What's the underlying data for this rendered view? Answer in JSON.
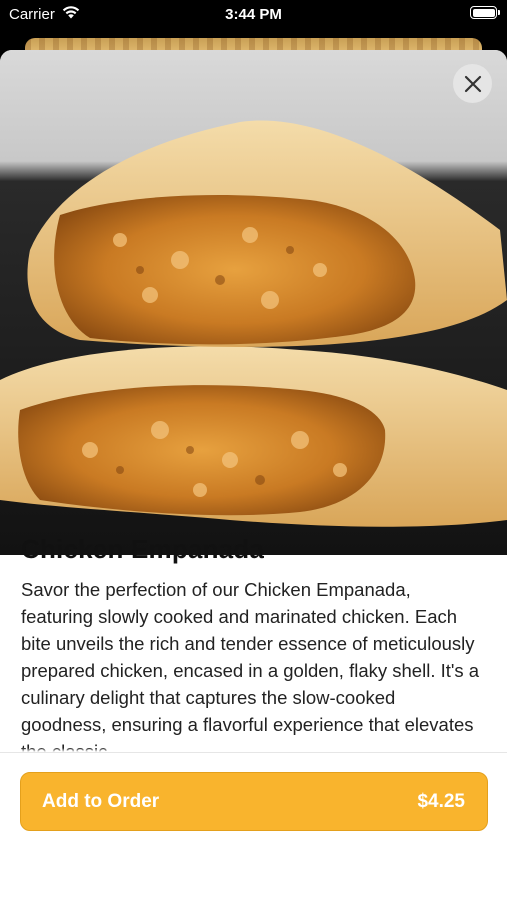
{
  "status_bar": {
    "carrier": "Carrier",
    "time": "3:44 PM",
    "wifi_icon": "wifi-icon",
    "battery_icon": "battery-icon"
  },
  "item": {
    "image": "chicken-empanada-photo",
    "title": "Chicken Empanada",
    "description": "Savor the perfection of our Chicken Empanada, featuring slowly cooked and marinated chicken. Each bite unveils the rich and tender essence of meticulously prepared chicken, encased in a golden, flaky shell. It's a culinary delight that captures the slow-cooked goodness, ensuring a flavorful experience that elevates the classic"
  },
  "close_icon": "close-icon",
  "order_button": {
    "label": "Add to Order",
    "price": "$4.25"
  },
  "colors": {
    "accent": "#f9b42d",
    "accent_border": "#e4a01c",
    "text_primary": "#111111",
    "text_body": "#222222",
    "sheet_bg": "#ffffff",
    "screen_bg": "#000000"
  }
}
